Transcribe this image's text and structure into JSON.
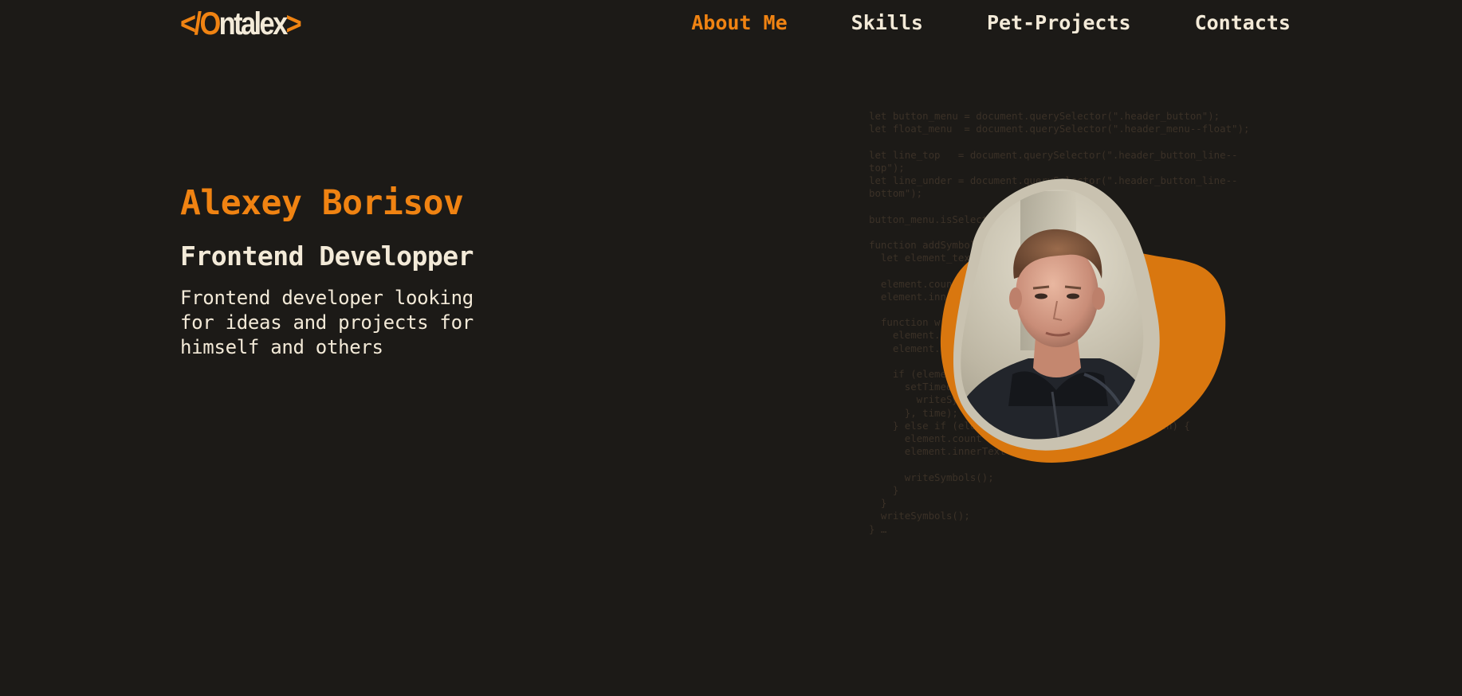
{
  "header": {
    "logo": {
      "open": "</",
      "o": "O",
      "rest": "ntalex",
      "close": ">"
    },
    "nav": [
      {
        "label": "About Me",
        "active": true
      },
      {
        "label": "Skills",
        "active": false
      },
      {
        "label": "Pet-Projects",
        "active": false
      },
      {
        "label": "Contacts",
        "active": false
      }
    ]
  },
  "hero": {
    "name": "Alexey Borisov",
    "role": "Frontend Developper",
    "description": "Frontend developer looking\nfor ideas and projects for\nhimself and others"
  },
  "background_code": "let button_menu = document.querySelector(\".header_button\");\nlet float_menu  = document.querySelector(\".header_menu--float\");\n\nlet line_top   = document.querySelector(\".header_button_line--\ntop\");\nlet line_under = document.querySelector(\".header_button_line--\nbottom\");\n\nbutton_menu.isSelected = false;\n\nfunction addSymbols(element) {\n  let element_text = element.innerText;\n\n  element.count = 0;\n  element.innerText = \"\";\n\n  function writeSymbols() {\n    element.count++;\n    element.innerText += element_text[element.count];\n\n    if (element.count < element_text.length) {\n      setTimeout(() => {\n        writeSymbols();\n      }, time);\n    } else if (element.count >= element_text.length) {\n      element.count = 0;\n      element.innerText = element_text;\n\n      writeSymbols();\n    }\n  }\n  writeSymbols();\n} …",
  "colors": {
    "background": "#1c1a17",
    "accent": "#f08312",
    "text": "#f3ead8",
    "blob_back": "#d9770f",
    "blob_front": "#c9c2b0"
  },
  "photo": {
    "alt": "portrait-photo"
  }
}
